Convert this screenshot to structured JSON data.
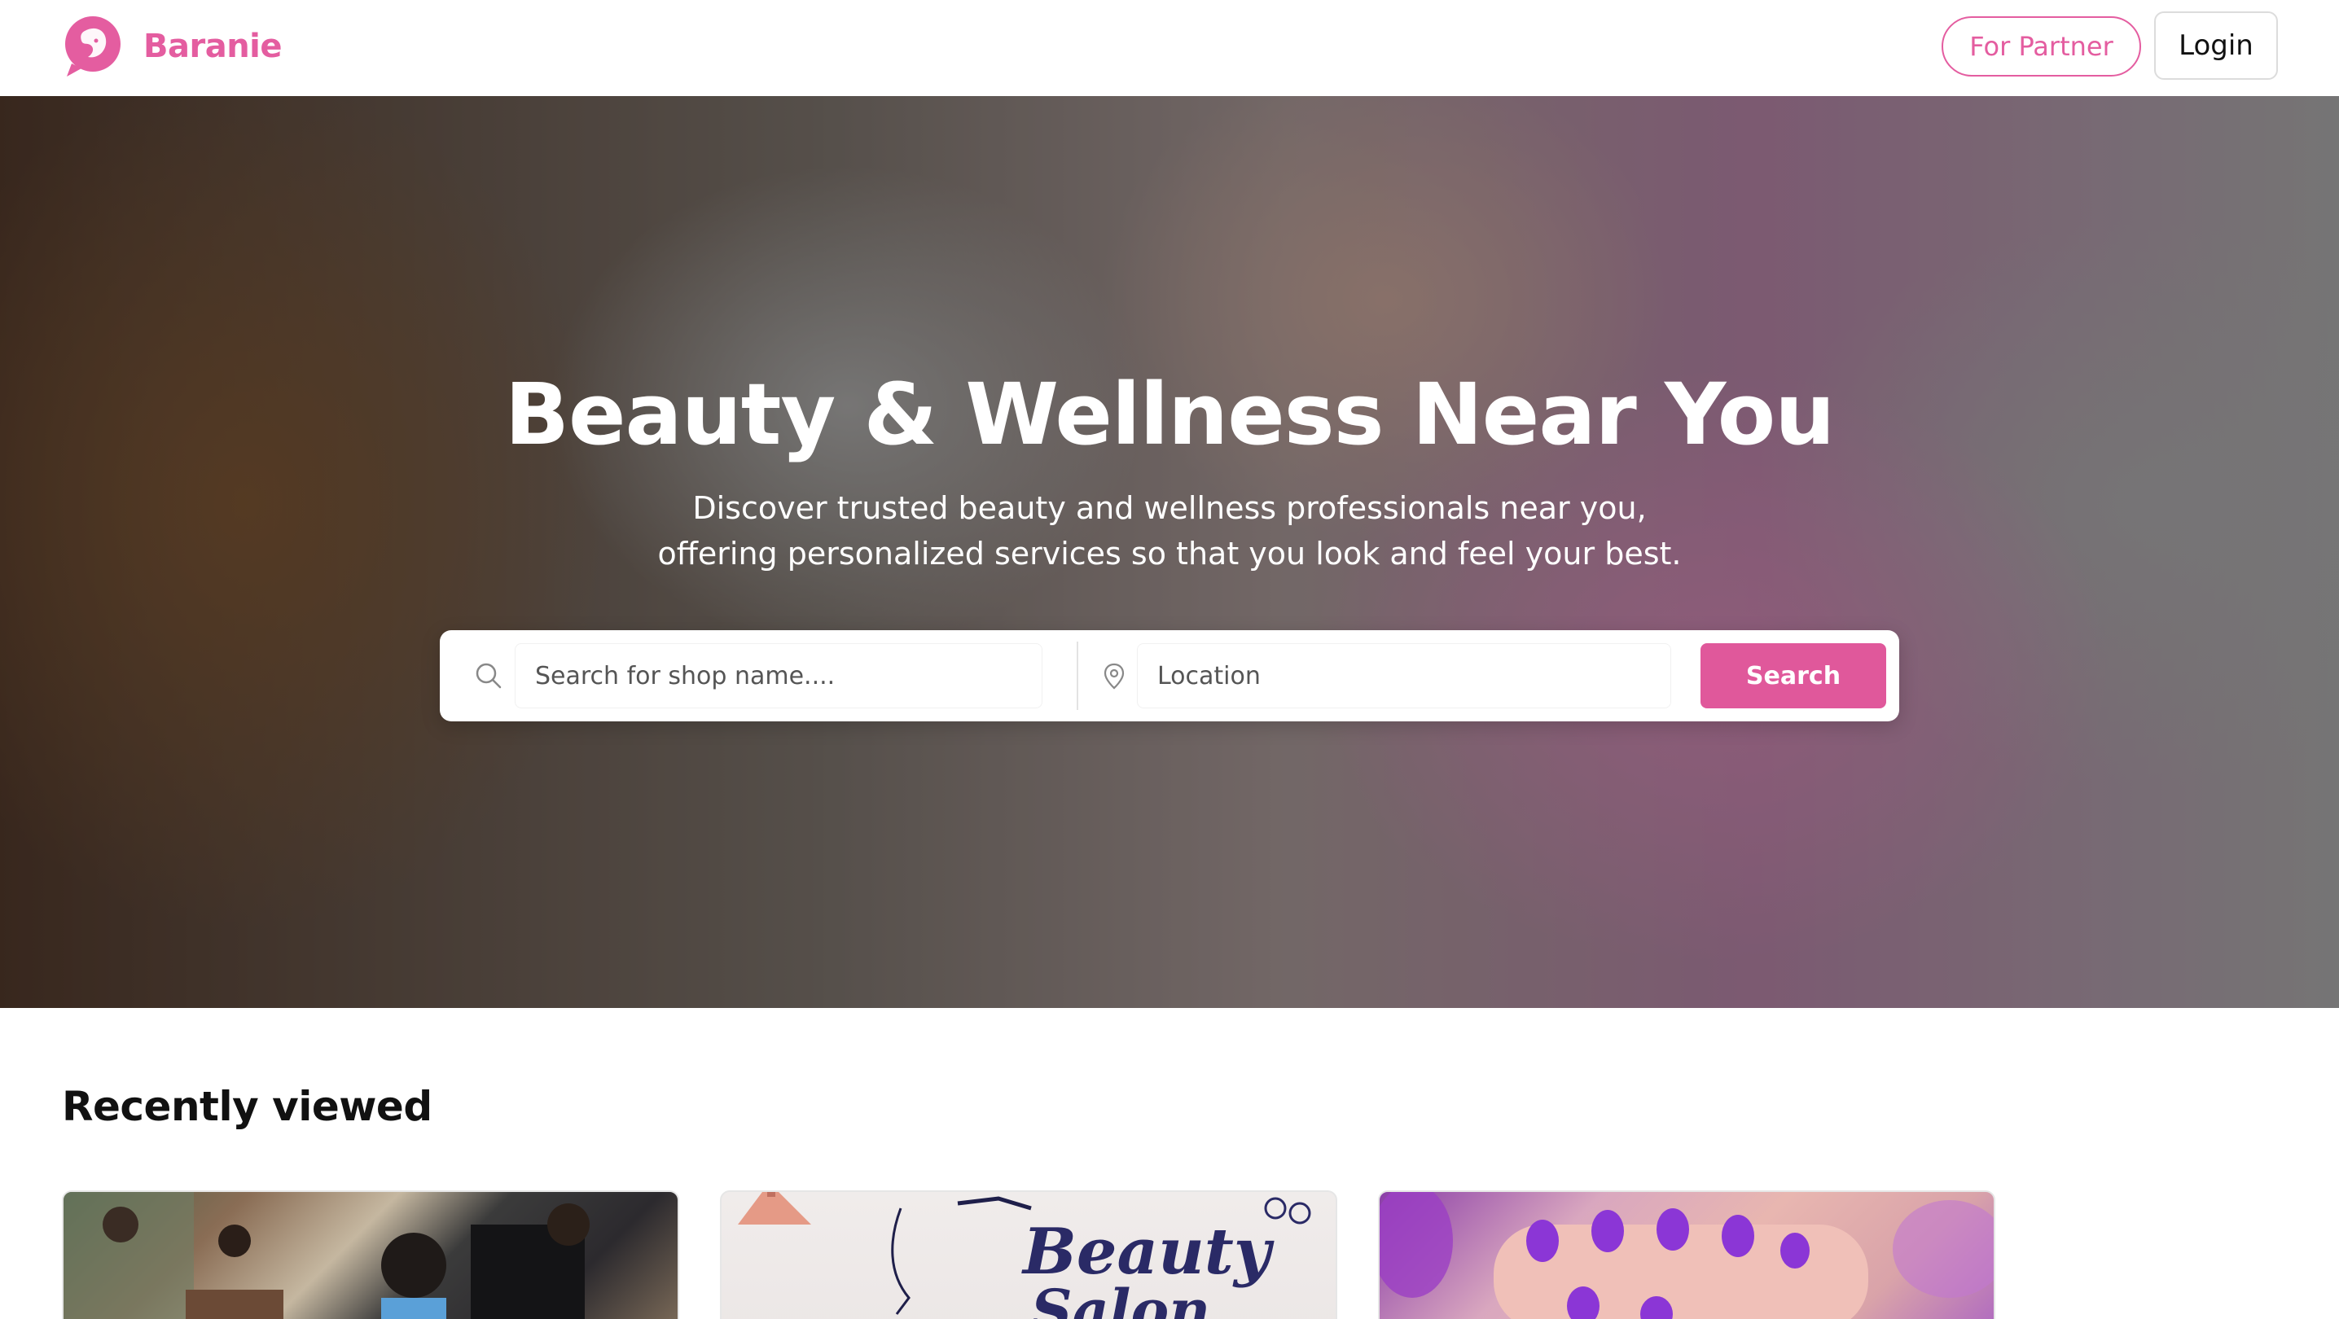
{
  "header": {
    "brand": "Baranie",
    "partner_label": "For Partner",
    "login_label": "Login"
  },
  "hero": {
    "title": "Beauty & Wellness Near You",
    "subtitle": "Discover trusted beauty and wellness professionals near you, offering personalized services so that you look and feel your best.",
    "search": {
      "shop_placeholder": "Search for shop name....",
      "location_placeholder": "Location",
      "button_label": "Search"
    }
  },
  "recent": {
    "title": "Recently viewed",
    "cards": [
      {
        "image": "barber-shop-photo"
      },
      {
        "image": "beauty-salon-graphic",
        "overlay_text": "Beauty Salon"
      },
      {
        "image": "purple-nails-photo"
      }
    ]
  },
  "colors": {
    "brand_pink": "#e45da0",
    "search_button": "#e0589b"
  }
}
